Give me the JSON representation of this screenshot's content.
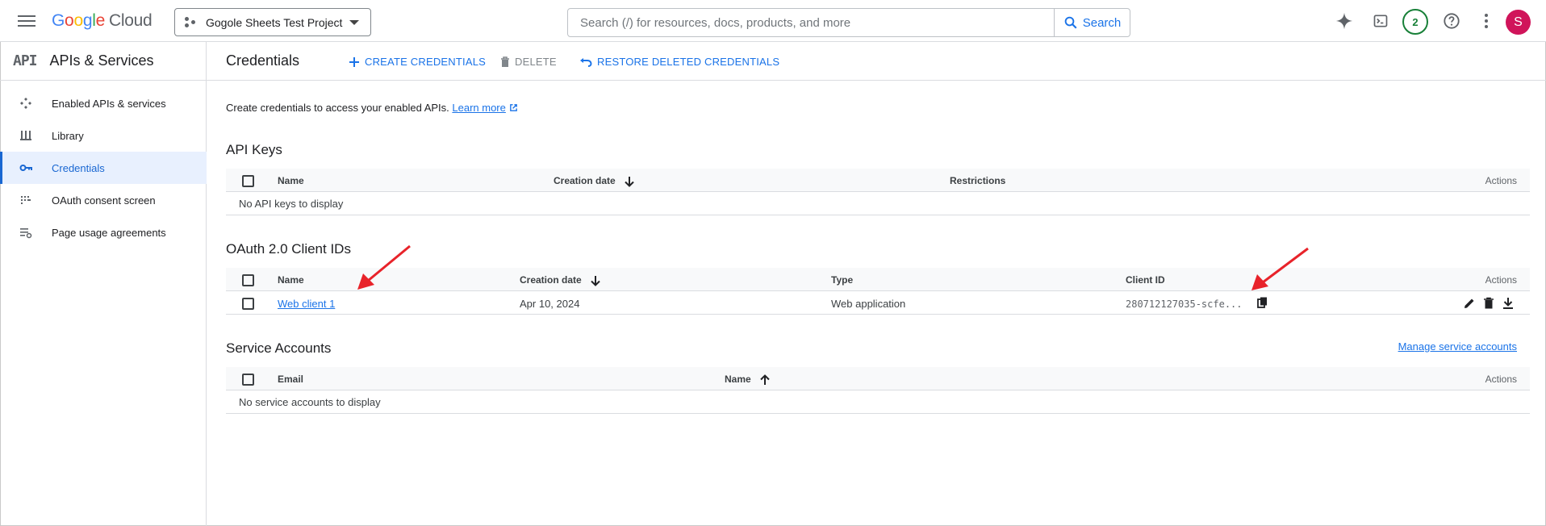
{
  "topbar": {
    "logo_letters": [
      "G",
      "o",
      "o",
      "g",
      "l",
      "e"
    ],
    "logo_product": "Cloud",
    "project_name": "Gogole Sheets Test Project",
    "search_placeholder": "Search (/) for resources, docs, products, and more",
    "search_button": "Search",
    "notifications_count": "2",
    "avatar_initial": "S"
  },
  "sidebar": {
    "logo": "API",
    "title": "APIs & Services",
    "items": [
      {
        "label": "Enabled APIs & services",
        "icon": "enabled-apis-icon"
      },
      {
        "label": "Library",
        "icon": "library-icon"
      },
      {
        "label": "Credentials",
        "icon": "key-icon",
        "active": true
      },
      {
        "label": "OAuth consent screen",
        "icon": "oauth-icon"
      },
      {
        "label": "Page usage agreements",
        "icon": "page-usage-icon"
      }
    ]
  },
  "main": {
    "title": "Credentials",
    "actions": {
      "create": "CREATE CREDENTIALS",
      "delete": "DELETE",
      "restore": "RESTORE DELETED CREDENTIALS"
    },
    "intro_text": "Create credentials to access your enabled APIs.",
    "learn_more": "Learn more",
    "api_keys": {
      "title": "API Keys",
      "columns": {
        "name": "Name",
        "creation_date": "Creation date",
        "restrictions": "Restrictions",
        "actions": "Actions"
      },
      "empty": "No API keys to display"
    },
    "oauth": {
      "title": "OAuth 2.0 Client IDs",
      "columns": {
        "name": "Name",
        "creation_date": "Creation date",
        "type": "Type",
        "client_id": "Client ID",
        "actions": "Actions"
      },
      "rows": [
        {
          "name": "Web client 1",
          "creation_date": "Apr 10, 2024",
          "type": "Web application",
          "client_id": "280712127035-scfe..."
        }
      ]
    },
    "service_accounts": {
      "title": "Service Accounts",
      "manage_link": "Manage service accounts",
      "columns": {
        "email": "Email",
        "name": "Name",
        "actions": "Actions"
      },
      "empty": "No service accounts to display"
    }
  },
  "colors": {
    "accent": "#1a73e8",
    "active_bg": "#e8f0fe",
    "annotation_arrow": "#e8232a",
    "avatar_bg": "#d0145a",
    "badge": "#188038"
  }
}
